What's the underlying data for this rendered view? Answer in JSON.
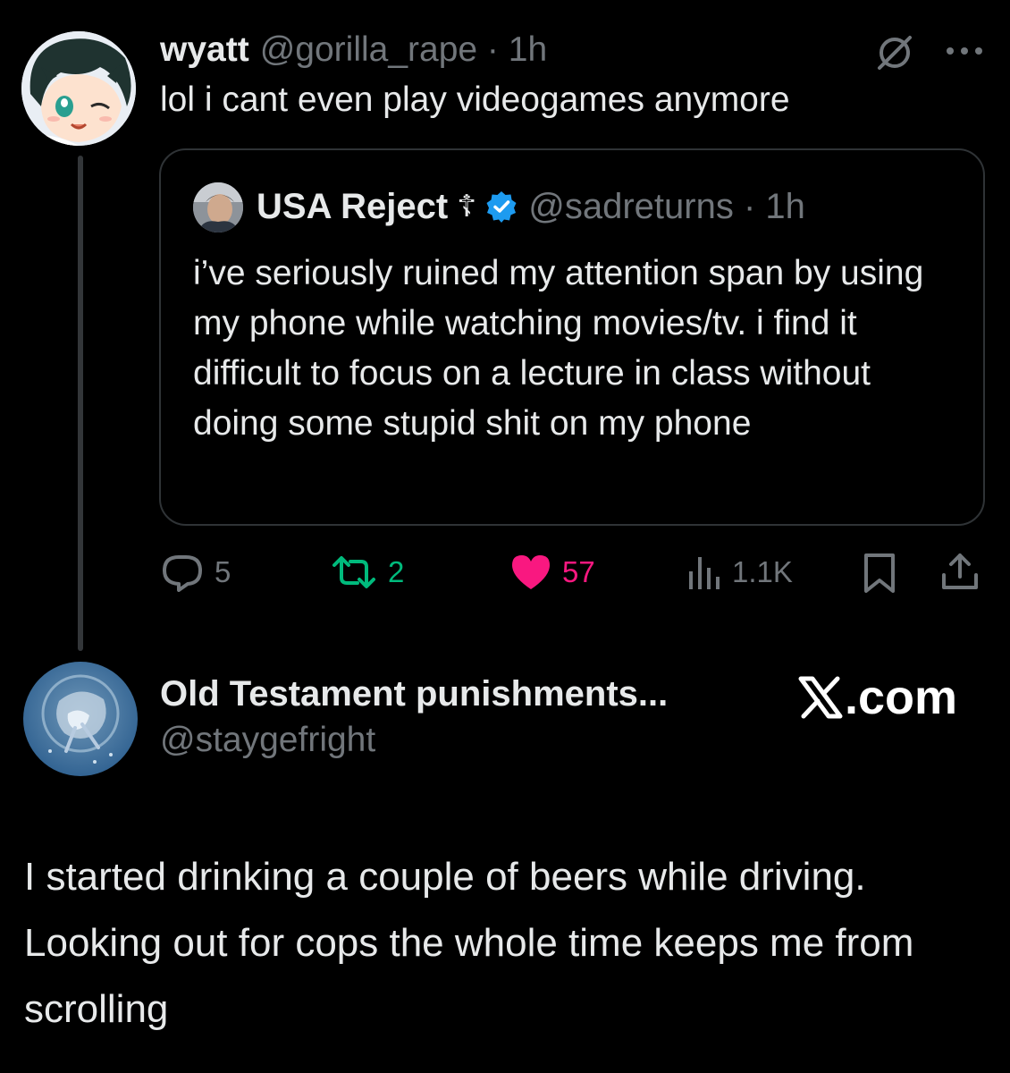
{
  "tweet": {
    "author": {
      "name": "wyatt",
      "handle": "@gorilla_rape",
      "meta": "@gorilla_rape · 1h",
      "time": "1h"
    },
    "text": "lol i cant even play videogames anymore",
    "header_icons": [
      "grok-icon",
      "more-icon"
    ],
    "quote": {
      "author": {
        "name": "USA Reject",
        "symbol": "☦",
        "verified_icon": "verified-badge-icon",
        "handle": "@sadreturns",
        "meta": "@sadreturns · 1h"
      },
      "text": "i’ve seriously ruined my attention span by using my phone while watching movies/tv. i find it difficult to focus on a lecture in class without doing some stupid shit on my phone"
    },
    "actions": {
      "reply": {
        "icon": "reply-icon",
        "count": "5"
      },
      "retweet": {
        "icon": "retweet-icon",
        "count": "2"
      },
      "like": {
        "icon": "heart-icon",
        "count": "57"
      },
      "views": {
        "icon": "views-icon",
        "count": "1.1K"
      },
      "bookmark": {
        "icon": "bookmark-icon"
      },
      "share": {
        "icon": "share-icon"
      }
    }
  },
  "reply": {
    "author": {
      "name": "Old Testament punishments...",
      "handle": "@staygefright"
    },
    "watermark": {
      "icon": "x-logo-icon",
      "text": ".com"
    },
    "text": "I started drinking a couple of beers while driving. Looking out for cops the whole time keeps me from scrolling"
  },
  "colors": {
    "background": "#000000",
    "text": "#e7e9ea",
    "secondary": "#71767b",
    "border": "#2f3336",
    "retweet": "#00ba7c",
    "like": "#f91880",
    "verified": "#1d9bf0"
  }
}
